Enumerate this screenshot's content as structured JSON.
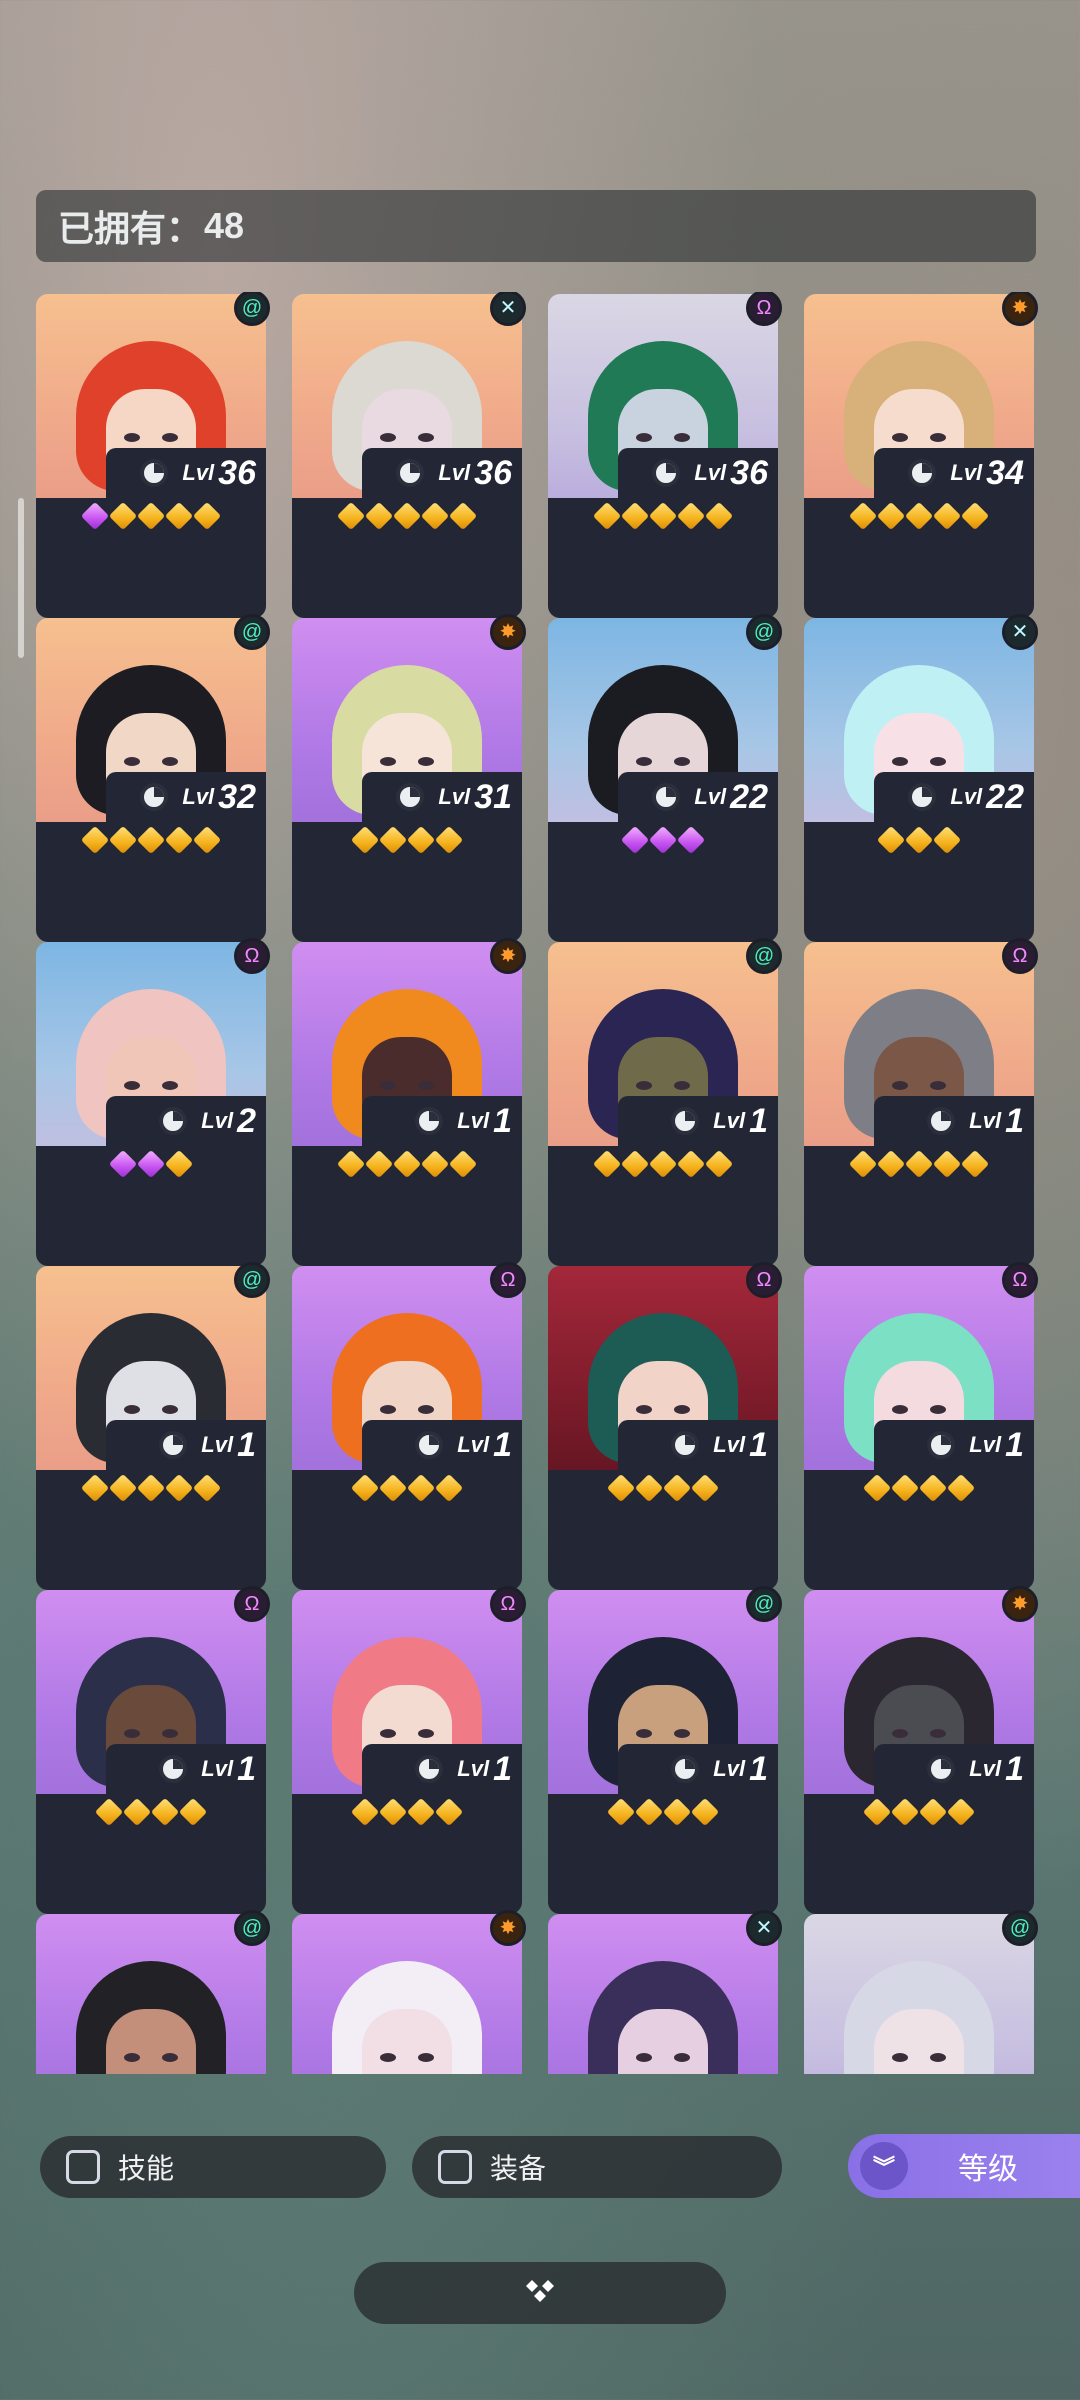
{
  "owned": {
    "label": "已拥有：",
    "count": "48"
  },
  "heroes": [
    {
      "level": "36",
      "lvl_label": "Lvl",
      "bg": "peach",
      "element": "swirl",
      "hair": "#e0412b",
      "skin": "#f6d6c4",
      "gems": [
        "purple",
        "gold",
        "gold",
        "gold",
        "gold"
      ]
    },
    {
      "level": "36",
      "lvl_label": "Lvl",
      "bg": "peach",
      "element": "cross",
      "hair": "#dcd8d2",
      "skin": "#e9d9e0",
      "gems": [
        "gold",
        "gold",
        "gold",
        "gold",
        "gold"
      ]
    },
    {
      "level": "36",
      "lvl_label": "Lvl",
      "bg": "gray",
      "element": "omega",
      "hair": "#1f7a55",
      "skin": "#c9d2df",
      "gems": [
        "gold",
        "gold",
        "gold",
        "gold",
        "gold"
      ]
    },
    {
      "level": "34",
      "lvl_label": "Lvl",
      "bg": "peach",
      "element": "sun",
      "hair": "#d8b07a",
      "skin": "#f6dccd",
      "gems": [
        "gold",
        "gold",
        "gold",
        "gold",
        "gold"
      ]
    },
    {
      "level": "32",
      "lvl_label": "Lvl",
      "bg": "peach",
      "element": "swirl",
      "hair": "#1c1c22",
      "skin": "#f0d7c6",
      "gems": [
        "gold",
        "gold",
        "gold",
        "gold",
        "gold"
      ]
    },
    {
      "level": "31",
      "lvl_label": "Lvl",
      "bg": "purple",
      "element": "sun",
      "hair": "#d9dca2",
      "skin": "#f6e4d8",
      "gems": [
        "gold",
        "gold",
        "gold",
        "gold"
      ]
    },
    {
      "level": "22",
      "lvl_label": "Lvl",
      "bg": "blue",
      "element": "swirl",
      "hair": "#1b1b22",
      "skin": "#e6d6d8",
      "gems": [
        "purple",
        "purple",
        "purple"
      ]
    },
    {
      "level": "22",
      "lvl_label": "Lvl",
      "bg": "blue",
      "element": "cross",
      "hair": "#bff0f3",
      "skin": "#f7e1e6",
      "gems": [
        "gold",
        "gold",
        "gold"
      ]
    },
    {
      "level": "2",
      "lvl_label": "Lvl",
      "bg": "blue",
      "element": "omega",
      "hair": "#f0c4c0",
      "skin": "#efc6b8",
      "gems": [
        "purple",
        "purple",
        "gold"
      ]
    },
    {
      "level": "1",
      "lvl_label": "Lvl",
      "bg": "purple",
      "element": "sun",
      "hair": "#f08a1f",
      "skin": "#4b2c2c",
      "gems": [
        "gold",
        "gold",
        "gold",
        "gold",
        "gold"
      ]
    },
    {
      "level": "1",
      "lvl_label": "Lvl",
      "bg": "peach",
      "element": "swirl",
      "hair": "#2a2552",
      "skin": "#6e6a4a",
      "gems": [
        "gold",
        "gold",
        "gold",
        "gold",
        "gold"
      ]
    },
    {
      "level": "1",
      "lvl_label": "Lvl",
      "bg": "peach",
      "element": "omega",
      "hair": "#7e7f86",
      "skin": "#7b5748",
      "gems": [
        "gold",
        "gold",
        "gold",
        "gold",
        "gold"
      ]
    },
    {
      "level": "1",
      "lvl_label": "Lvl",
      "bg": "peach",
      "element": "swirl",
      "hair": "#2a2c33",
      "skin": "#dfe0e6",
      "gems": [
        "gold",
        "gold",
        "gold",
        "gold",
        "gold"
      ]
    },
    {
      "level": "1",
      "lvl_label": "Lvl",
      "bg": "purple",
      "element": "omega",
      "hair": "#ee6f1f",
      "skin": "#f0d5c6",
      "gems": [
        "gold",
        "gold",
        "gold",
        "gold"
      ]
    },
    {
      "level": "1",
      "lvl_label": "Lvl",
      "bg": "red",
      "element": "omega",
      "hair": "#1d5b55",
      "skin": "#f2d3c8",
      "gems": [
        "gold",
        "gold",
        "gold",
        "gold"
      ]
    },
    {
      "level": "1",
      "lvl_label": "Lvl",
      "bg": "purple",
      "element": "omega",
      "hair": "#7be0c4",
      "skin": "#f4dbe0",
      "gems": [
        "gold",
        "gold",
        "gold",
        "gold"
      ]
    },
    {
      "level": "1",
      "lvl_label": "Lvl",
      "bg": "purple",
      "element": "omega",
      "hair": "#2b2f4a",
      "skin": "#6a4a3a",
      "gems": [
        "gold",
        "gold",
        "gold",
        "gold"
      ]
    },
    {
      "level": "1",
      "lvl_label": "Lvl",
      "bg": "purple",
      "element": "omega",
      "hair": "#f07b86",
      "skin": "#f4dbd2",
      "gems": [
        "gold",
        "gold",
        "gold",
        "gold"
      ]
    },
    {
      "level": "1",
      "lvl_label": "Lvl",
      "bg": "purple",
      "element": "swirl",
      "hair": "#1e2235",
      "skin": "#c9a07e",
      "gems": [
        "gold",
        "gold",
        "gold",
        "gold"
      ]
    },
    {
      "level": "1",
      "lvl_label": "Lvl",
      "bg": "purple",
      "element": "sun",
      "hair": "#2a2730",
      "skin": "#4b4b52",
      "gems": [
        "gold",
        "gold",
        "gold",
        "gold"
      ]
    },
    {
      "level": "",
      "lvl_label": "",
      "bg": "purple",
      "element": "swirl",
      "hair": "#222226",
      "skin": "#c48f7a",
      "gems": []
    },
    {
      "level": "",
      "lvl_label": "",
      "bg": "purple",
      "element": "sun",
      "hair": "#f3eef6",
      "skin": "#f2dfe6",
      "gems": []
    },
    {
      "level": "",
      "lvl_label": "",
      "bg": "purple",
      "element": "cross",
      "hair": "#3a2f5a",
      "skin": "#e6cfe0",
      "gems": []
    },
    {
      "level": "",
      "lvl_label": "",
      "bg": "gray",
      "element": "swirl",
      "hair": "#d6d8e6",
      "skin": "#efe2e6",
      "gems": []
    }
  ],
  "filters": {
    "skill_label": "技能",
    "equip_label": "装备",
    "sort_label": "等级",
    "sort_icon": "chevron-double-down-icon"
  },
  "collapse": {
    "icon": "diamond-cluster-icon"
  },
  "element_icons": {
    "swirl": "swirl-icon",
    "cross": "cross-icon",
    "omega": "omega-icon",
    "sun": "sun-icon"
  }
}
